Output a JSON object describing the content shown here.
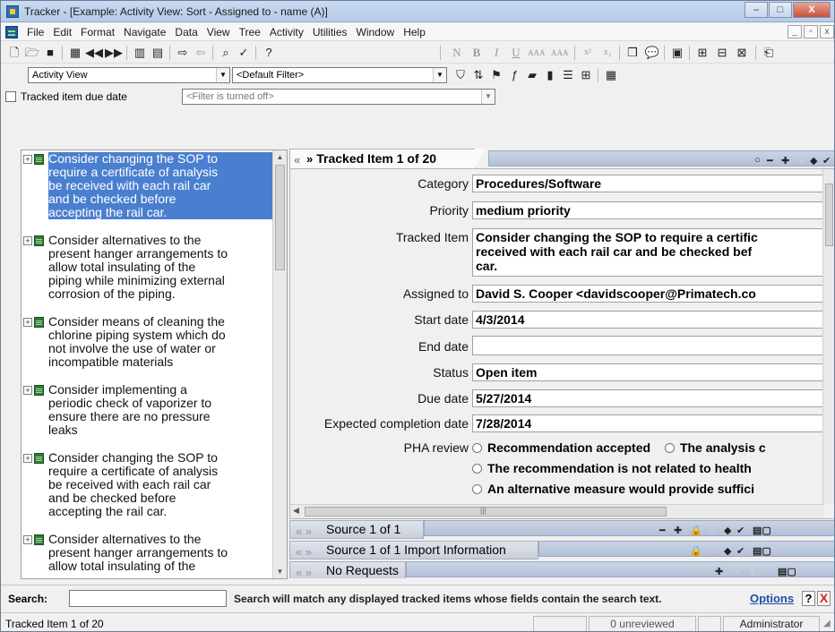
{
  "window": {
    "title": "Tracker - [Example: Activity View: Sort -  Assigned to - name (A)]",
    "min": "–",
    "max": "□",
    "close": "X"
  },
  "menu": [
    "File",
    "Edit",
    "Format",
    "Navigate",
    "Data",
    "View",
    "Tree",
    "Activity",
    "Utilities",
    "Window",
    "Help"
  ],
  "mdi": {
    "min": "_",
    "restore": "▫",
    "close": "x"
  },
  "view_combo": {
    "value": "Activity View"
  },
  "filter_combo": {
    "value": "<Default Filter>"
  },
  "filter2": {
    "checkbox_label": "Tracked item due date",
    "value": "<Filter is turned off>"
  },
  "tree": {
    "items": [
      "Consider changing the SOP to\nrequire a certificate of analysis\nbe received with each rail car\nand be checked before\naccepting the rail car.",
      "Consider alternatives to the\npresent hanger arrangements to\nallow total insulating of the\npiping while minimizing external\ncorrosion of the piping.",
      "Consider means of cleaning the\nchlorine piping system which do\nnot involve the use of water or\nincompatible materials",
      "Consider implementing a\nperiodic check of vaporizer to\nensure there are no pressure\nleaks",
      "Consider changing the SOP to\nrequire a certificate of analysis\nbe received with each rail car\nand be checked before\naccepting the rail car.",
      "Consider alternatives to the\npresent hanger arrangements to\nallow total insulating of the"
    ]
  },
  "detail": {
    "header": "Tracked Item 1 of 20",
    "fields": [
      {
        "label": "Category",
        "value": "Procedures/Software"
      },
      {
        "label": "Priority",
        "value": "medium priority"
      },
      {
        "label": "Tracked Item",
        "value": "Consider changing the SOP to require a certific\nreceived with each rail car and be checked bef\ncar."
      },
      {
        "label": "Assigned to",
        "value": "David S. Cooper <davidscooper@Primatech.co"
      },
      {
        "label": "Start date",
        "value": "4/3/2014"
      },
      {
        "label": "End date",
        "value": ""
      },
      {
        "label": "Status",
        "value": "Open item"
      },
      {
        "label": "Due date",
        "value": "5/27/2014"
      },
      {
        "label": "Expected completion date",
        "value": "7/28/2014"
      }
    ],
    "pha_label": "PHA review",
    "pha_options": [
      "Recommendation accepted",
      "The analysis c",
      "The recommendation is not related to health",
      "An alternative measure would provide suffici"
    ]
  },
  "subpanes": [
    "Source 1 of 1",
    "Source 1 of 1 Import Information",
    "No Requests"
  ],
  "search": {
    "label": "Search:",
    "hint": "Search will match any displayed tracked items whose fields contain the search text.",
    "options": "Options",
    "help": "?",
    "close": "X"
  },
  "status": {
    "left": "Tracked Item 1 of 20",
    "unreviewed": "0 unreviewed",
    "user": "Administrator"
  },
  "colors": {
    "selection": "#4a7fcf",
    "pane_bar": "#b3c0d6",
    "link": "#1f4ea8",
    "close_red": "#d42020"
  }
}
